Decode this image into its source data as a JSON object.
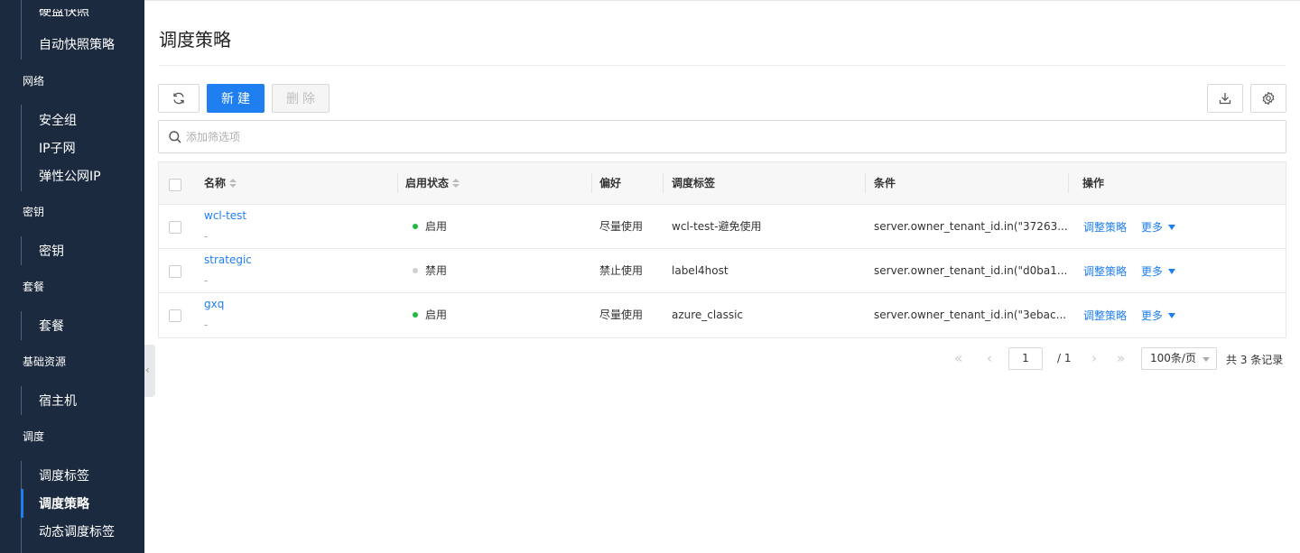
{
  "sidebar": {
    "top_partial": "硬盘快照",
    "items_top": [
      "自动快照策略"
    ],
    "groups": [
      {
        "title": "网络",
        "items": [
          "安全组",
          "IP子网",
          "弹性公网IP"
        ]
      },
      {
        "title": "密钥",
        "items": [
          "密钥"
        ]
      },
      {
        "title": "套餐",
        "items": [
          "套餐"
        ]
      },
      {
        "title": "基础资源",
        "items": [
          "宿主机"
        ]
      },
      {
        "title": "调度",
        "items": [
          "调度标签",
          "调度策略",
          "动态调度标签"
        ]
      }
    ],
    "active_item": "调度策略",
    "collapse_icon": "‹"
  },
  "page": {
    "title": "调度策略"
  },
  "toolbar": {
    "new_label": "新建",
    "delete_label": "删除",
    "refresh_icon": "refresh-icon",
    "download_icon": "download-icon",
    "settings_icon": "gear-icon"
  },
  "search": {
    "placeholder": "添加筛选项"
  },
  "table": {
    "columns": [
      "名称",
      "启用状态",
      "偏好",
      "调度标签",
      "条件",
      "操作"
    ],
    "rows": [
      {
        "name": "wcl-test",
        "sub": "-",
        "status": "启用",
        "status_color": "#1fba3b",
        "preference": "尽量使用",
        "tag": "wcl-test-避免使用",
        "condition": "server.owner_tenant_id.in(\"37263...",
        "action": "调整策略",
        "more": "更多"
      },
      {
        "name": "strategic",
        "sub": "-",
        "status": "禁用",
        "status_color": "#d0d0d0",
        "preference": "禁止使用",
        "tag": "label4host",
        "condition": "server.owner_tenant_id.in(\"d0ba1...",
        "action": "调整策略",
        "more": "更多"
      },
      {
        "name": "gxq",
        "sub": "-",
        "status": "启用",
        "status_color": "#1fba3b",
        "preference": "尽量使用",
        "tag": "azure_classic",
        "condition": "server.owner_tenant_id.in(\"3ebac...",
        "action": "调整策略",
        "more": "更多"
      }
    ]
  },
  "pagination": {
    "first": "«",
    "prev": "‹",
    "current": "1",
    "total_pages": "/ 1",
    "next": "›",
    "last": "»",
    "page_size": "100条/页",
    "record_count": "共 3 条记录"
  },
  "colors": {
    "sidebar_bg": "#1b2a3f",
    "accent": "#1f7ff0"
  }
}
